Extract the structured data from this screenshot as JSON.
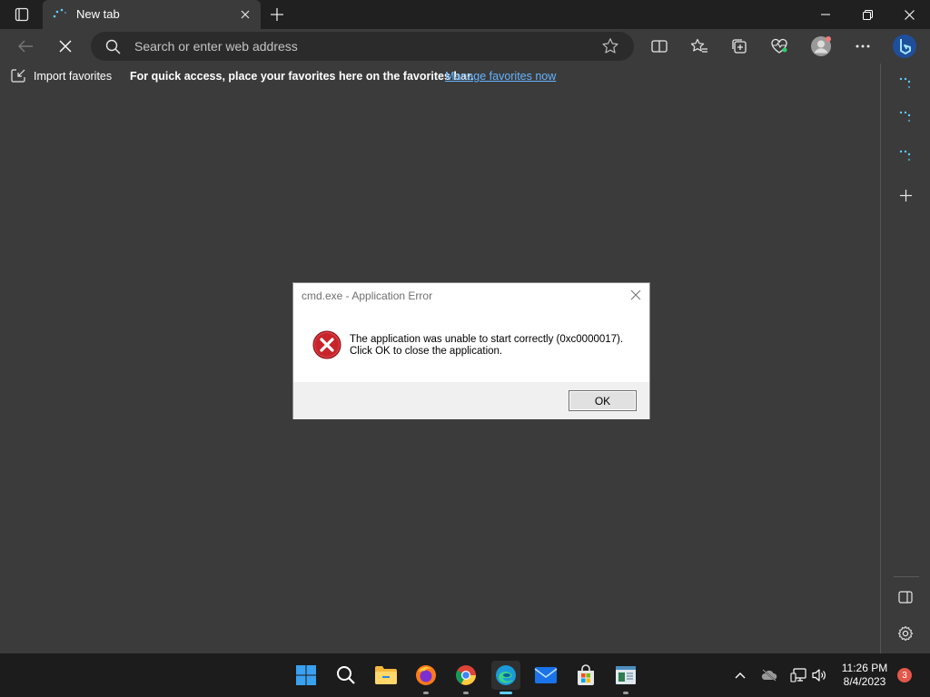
{
  "browser": {
    "tab": {
      "title": "New tab"
    },
    "address_bar": {
      "placeholder": "Search or enter web address",
      "value": ""
    },
    "favorites_bar": {
      "import_label": "Import favorites",
      "hint": "For quick access, place your favorites here on the favorites bar.",
      "manage_link": "Manage favorites now"
    }
  },
  "dialog": {
    "title": "cmd.exe - Application Error",
    "message_line1": "The application was unable to start correctly (0xc0000017).",
    "message_line2": "Click OK to close the application.",
    "ok_label": "OK"
  },
  "taskbar": {
    "time": "11:26 PM",
    "date": "8/4/2023",
    "notification_count": "3"
  },
  "colors": {
    "accent": "#60cdff",
    "link": "#66b4ff",
    "error_red": "#c8242b",
    "badge": "#e2584a"
  }
}
